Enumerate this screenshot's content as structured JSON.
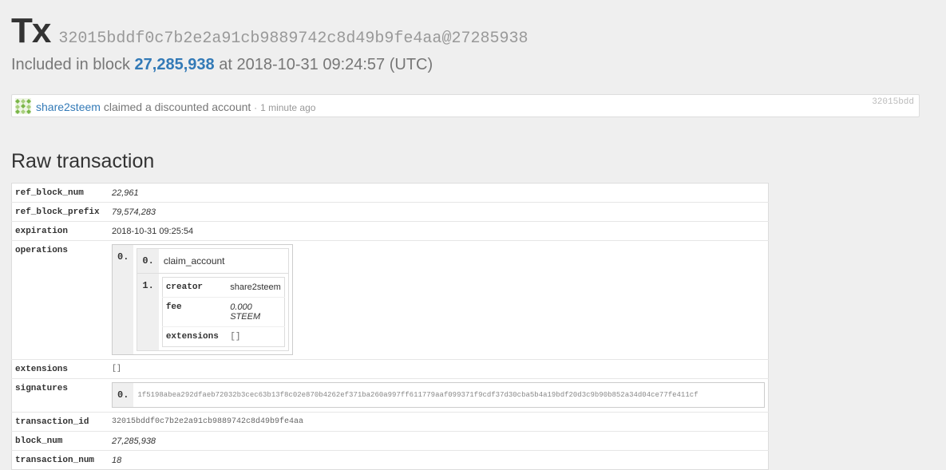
{
  "header": {
    "tx_label": "Tx",
    "tx_hash": "32015bddf0c7b2e2a91cb9889742c8d49b9fe4aa@27285938",
    "included_prefix": "Included in block",
    "block_link": "27,285,938",
    "included_suffix": "at 2018-10-31 09:24:57 (UTC)"
  },
  "op_card": {
    "account": "share2steem",
    "action": "claimed a discounted account",
    "separator": "·",
    "time_ago": "1 minute ago",
    "short_id": "32015bdd"
  },
  "raw": {
    "heading": "Raw transaction",
    "rows": {
      "ref_block_num": {
        "key": "ref_block_num",
        "value": "22,961"
      },
      "ref_block_prefix": {
        "key": "ref_block_prefix",
        "value": "79,574,283"
      },
      "expiration": {
        "key": "expiration",
        "value": "2018-10-31 09:25:54"
      },
      "operations": {
        "key": "operations"
      },
      "extensions": {
        "key": "extensions",
        "value": "[]"
      },
      "signatures": {
        "key": "signatures"
      },
      "transaction_id": {
        "key": "transaction_id",
        "value": "32015bddf0c7b2e2a91cb9889742c8d49b9fe4aa"
      },
      "block_num": {
        "key": "block_num",
        "value": "27,285,938"
      },
      "transaction_num": {
        "key": "transaction_num",
        "value": "18"
      }
    },
    "operations": {
      "outer_index": "0.",
      "op_index": "0.",
      "op_name": "claim_account",
      "params_index": "1.",
      "params": [
        {
          "key": "creator",
          "value": "share2steem"
        },
        {
          "key": "fee",
          "value": "0.000 STEEM"
        },
        {
          "key": "extensions",
          "value": "[]"
        }
      ]
    },
    "signatures": {
      "index": "0.",
      "value": "1f5198abea292dfaeb72032b3cec63b13f8c02e870b4262ef371ba260a997ff611779aaf099371f9cdf37d30cba5b4a19bdf20d3c9b90b852a34d04ce77fe411cf"
    }
  }
}
